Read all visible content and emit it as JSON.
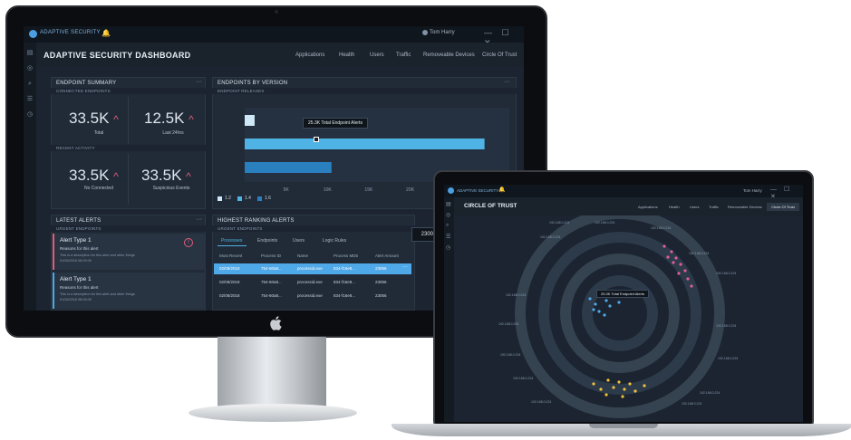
{
  "monitor": {
    "app_name": "ADAPTIVE SECURITY",
    "user_name": "Tom Harry",
    "window_controls": "— ☐ ✕",
    "dashboard_title": "ADAPTIVE SECURITY DASHBOARD",
    "nav": [
      "Applications",
      "Health",
      "Users",
      "Traffic",
      "Removeable Devices",
      "Circle Of Trust"
    ],
    "endpoint_summary": {
      "title": "ENDPOINT SUMMARY",
      "connected_label": "CONNECTED ENDPOINTS",
      "recent_label": "RECENT ACTIVITY",
      "tiles": [
        {
          "value": "33.5K",
          "caption": "Total"
        },
        {
          "value": "12.5K",
          "caption": "Last 24hrs"
        },
        {
          "value": "33.5K",
          "caption": "No Connected"
        },
        {
          "value": "33.5K",
          "caption": "Suspicious Events"
        }
      ]
    },
    "endpoints_by_version": {
      "title": "ENDPOINTS BY VERSION",
      "subtitle": "ENDPOINT RELEASES",
      "tooltip": "25.3K Total Endpoint Alerts",
      "x_ticks": [
        "5K",
        "10K",
        "15K",
        "20K",
        "25K",
        "30K"
      ],
      "legend": [
        "1.2",
        "1.4",
        "1.6"
      ]
    },
    "latest_alerts": {
      "title": "LATEST ALERTS",
      "subtitle": "URGENT ENDPOINTS",
      "items": [
        {
          "title": "Alert Type 1",
          "reason": "Reasons for this alert",
          "desc": "This is a description for this alert and other things",
          "date": "01/26/2018 08:00:00"
        },
        {
          "title": "Alert Type 1",
          "reason": "Reasons for this alert",
          "desc": "This is a description for this alert and other things",
          "date": "01/26/2018 08:00:00"
        }
      ]
    },
    "highest_ranking": {
      "title": "HIGHEST RANKING ALERTS",
      "subtitle": "URGENT ENDPOINTS",
      "side_value": "23000",
      "tabs": [
        "Processes",
        "Endpoints",
        "Users",
        "Logic Rules"
      ],
      "columns": [
        "Most Recent",
        "Process ID",
        "Name",
        "Process MD5",
        "Alert Amount"
      ],
      "rows": [
        [
          "02/08/2018",
          "754-60a8...",
          "processid.exe",
          "834-f16e8...",
          "23056"
        ],
        [
          "02/08/2018",
          "754-60a8...",
          "processid.exe",
          "834-f16e8...",
          "23056"
        ],
        [
          "02/08/2018",
          "754-60a8...",
          "processid.exe",
          "834-f16e8...",
          "23056"
        ]
      ]
    },
    "chart_data": {
      "type": "bar",
      "categories": [
        "1.2",
        "1.4",
        "1.6"
      ],
      "values": [
        1200,
        29000,
        10500
      ],
      "xlim": [
        0,
        32000
      ],
      "x_ticks": [
        5000,
        10000,
        15000,
        20000,
        25000,
        30000
      ],
      "colors": [
        "#cfe8f7",
        "#4fb3e6",
        "#2a7fbf"
      ]
    }
  },
  "laptop": {
    "app_name": "ADAPTIVE SECURITY",
    "user_name": "Tom Harry",
    "page_title": "CIRCLE OF TRUST",
    "nav": [
      "Applications",
      "Health",
      "Users",
      "Traffic",
      "Removeable Devices",
      "Circle Of Trust"
    ],
    "tooltip": "25.3K Total Endpoint Alerts",
    "ip_label": "192.168.0.224",
    "colors": {
      "blue": "#4fa8e8",
      "pink": "#e35d9a",
      "yellow": "#f0c23a"
    }
  }
}
